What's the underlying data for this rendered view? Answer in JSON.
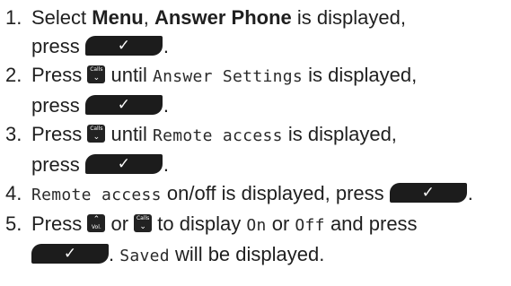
{
  "steps": [
    {
      "number": "1.",
      "t1": "Select ",
      "b1": "Menu",
      "t2": ", ",
      "b2": "Answer Phone",
      "t3": " is displayed,",
      "t4": "press ",
      "end": "."
    },
    {
      "number": "2.",
      "t1": "Press ",
      "t2": " until ",
      "lcd": "Answer Settings",
      "t3": " is displayed,",
      "t4": "press ",
      "end": "."
    },
    {
      "number": "3.",
      "t1": "Press ",
      "t2": " until ",
      "lcd": "Remote access",
      "t3": " is displayed,",
      "t4": "press ",
      "end": "."
    },
    {
      "number": "4.",
      "lcd": "Remote access",
      "t1": " on/off is displayed, press ",
      "end": "."
    },
    {
      "number": "5.",
      "t1": "Press ",
      "t2": " or ",
      "t3": " to display ",
      "lcd_on": "On",
      "t4": " or ",
      "lcd_off": "Off",
      "t5": " and press",
      "t6": ". ",
      "lcd_saved": "Saved",
      "t7": " will be displayed."
    }
  ],
  "keys": {
    "calls_label": "Calls",
    "vol_label": "Vol.",
    "down_glyph": "⌄",
    "up_glyph": "⌃",
    "ok_glyph": "✓"
  },
  "colors": {
    "text": "#1f1f1f",
    "button": "#1c1c1c"
  },
  "icons": [
    "ok-button-icon",
    "calls-down-key-icon",
    "vol-up-key-icon"
  ]
}
